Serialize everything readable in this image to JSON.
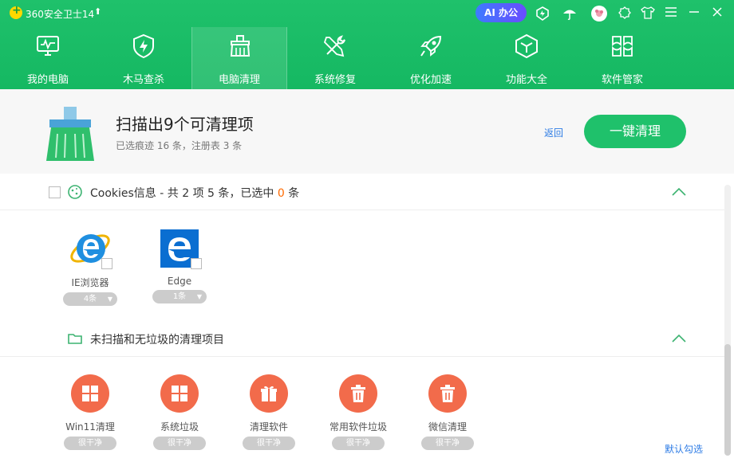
{
  "titlebar": {
    "app_title": "360安全卫士14",
    "ai_button": "AI 办公"
  },
  "nav": [
    {
      "label": "我的电脑"
    },
    {
      "label": "木马查杀"
    },
    {
      "label": "电脑清理"
    },
    {
      "label": "系统修复"
    },
    {
      "label": "优化加速"
    },
    {
      "label": "功能大全"
    },
    {
      "label": "软件管家"
    }
  ],
  "summary": {
    "title": "扫描出9个可清理项",
    "subtitle": "已选痕迹 16 条，注册表 3 条",
    "back": "返回",
    "clean_button": "一键清理"
  },
  "cookies": {
    "title_prefix": "Cookies信息 - 共 2 项 5 条，已选中 ",
    "selected": "0",
    "title_suffix": " 条",
    "browsers": [
      {
        "name": "IE浏览器",
        "count": "4条"
      },
      {
        "name": "Edge",
        "count": "1条"
      }
    ]
  },
  "unscanned": {
    "title": "未扫描和无垃圾的清理项目",
    "items": [
      {
        "name": "Win11清理",
        "status": "很干净"
      },
      {
        "name": "系统垃圾",
        "status": "很干净"
      },
      {
        "name": "清理软件",
        "status": "很干净"
      },
      {
        "name": "常用软件垃圾",
        "status": "很干净"
      },
      {
        "name": "微信清理",
        "status": "很干净"
      }
    ],
    "default_select": "默认勾选"
  },
  "colors": {
    "brand_green": "#1fc16b",
    "accent_orange": "#f26b4b",
    "link_blue": "#2c7be5"
  }
}
